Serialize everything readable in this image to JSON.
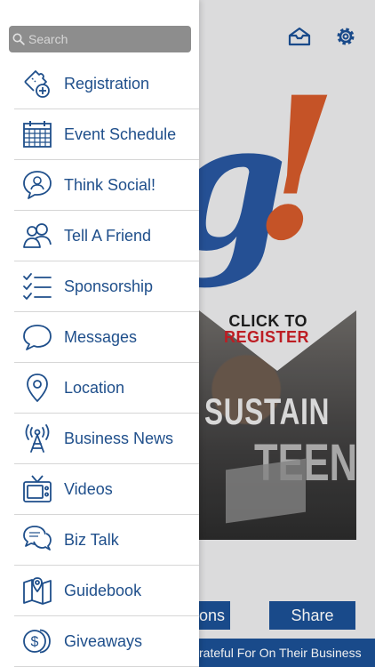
{
  "search": {
    "placeholder": "Search"
  },
  "menu": [
    {
      "label": "Registration",
      "icon": "ticket-add-icon"
    },
    {
      "label": "Event Schedule",
      "icon": "calendar-icon"
    },
    {
      "label": "Think Social!",
      "icon": "chat-user-icon"
    },
    {
      "label": "Tell A Friend",
      "icon": "friends-icon"
    },
    {
      "label": "Sponsorship",
      "icon": "checklist-icon"
    },
    {
      "label": "Messages",
      "icon": "speech-bubble-icon"
    },
    {
      "label": "Location",
      "icon": "map-pin-icon"
    },
    {
      "label": "Business News",
      "icon": "broadcast-tower-icon"
    },
    {
      "label": "Videos",
      "icon": "tv-icon"
    },
    {
      "label": "Biz Talk",
      "icon": "conversation-icon"
    },
    {
      "label": "Guidebook",
      "icon": "map-guide-icon"
    },
    {
      "label": "Giveaways",
      "icon": "coins-icon"
    }
  ],
  "background": {
    "promo_line1": "CLICK TO",
    "promo_line2": "REGISTER",
    "promo_word1": "SUSTAIN",
    "promo_word2": "TEEN",
    "left_button_fragment": "ons",
    "share_button": "Share",
    "ticker_text": "rateful For On Their Business"
  },
  "colors": {
    "menu_text": "#1f4f8b",
    "brand_blue": "#1b4f93",
    "accent_orange": "#d2592a",
    "register_red": "#c91f26",
    "search_bg": "#8d8d8d"
  }
}
